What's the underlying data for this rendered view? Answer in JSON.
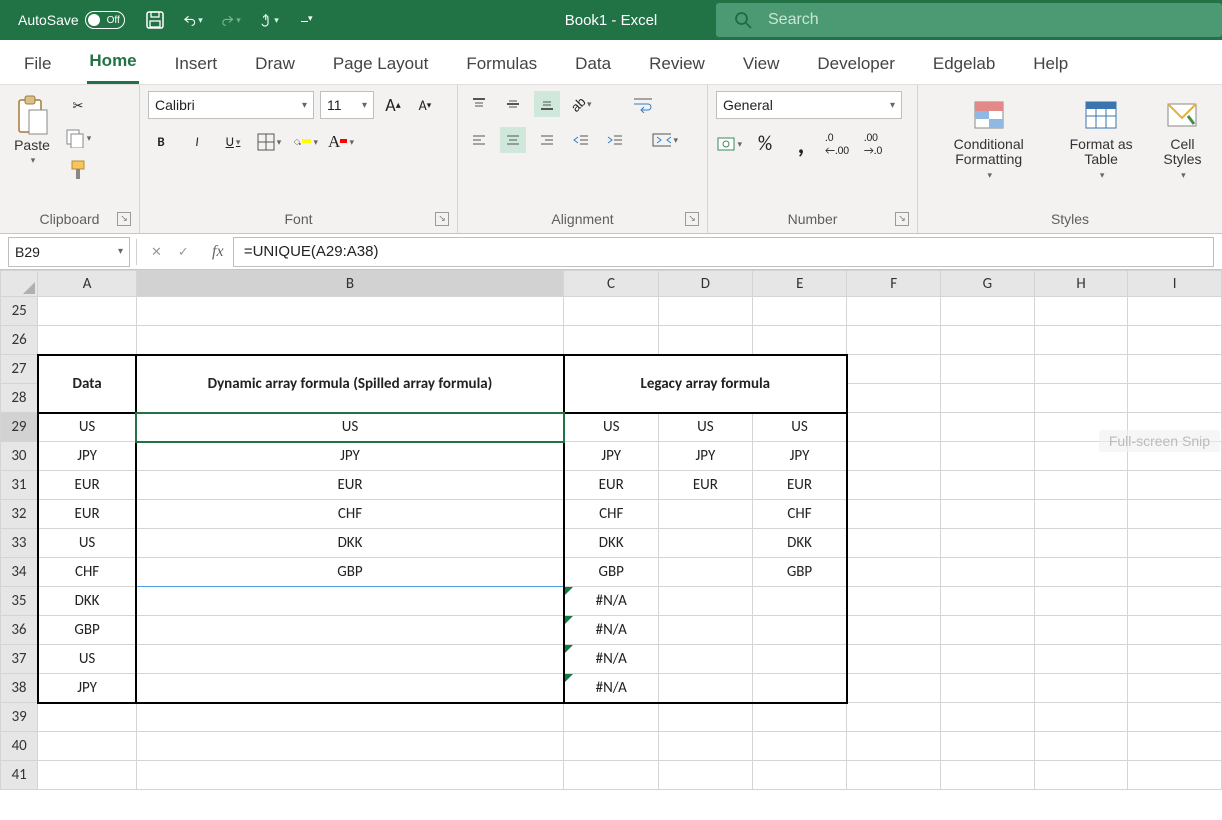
{
  "titlebar": {
    "autosave_label": "AutoSave",
    "autosave_state": "Off",
    "title": "Book1  -  Excel",
    "search_placeholder": "Search"
  },
  "tabs": [
    "File",
    "Home",
    "Insert",
    "Draw",
    "Page Layout",
    "Formulas",
    "Data",
    "Review",
    "View",
    "Developer",
    "Edgelab",
    "Help"
  ],
  "active_tab": "Home",
  "ribbon": {
    "clipboard": {
      "label": "Clipboard",
      "paste": "Paste"
    },
    "font": {
      "label": "Font",
      "name": "Calibri",
      "size": "11"
    },
    "alignment": {
      "label": "Alignment"
    },
    "number": {
      "label": "Number",
      "format": "General"
    },
    "styles": {
      "label": "Styles",
      "cond": "Conditional Formatting",
      "table": "Format as Table",
      "cellstyles": "Cell Styles"
    }
  },
  "fx": {
    "namebox": "B29",
    "formula": "=UNIQUE(A29:A38)"
  },
  "grid": {
    "columns": [
      "A",
      "B",
      "C",
      "D",
      "E",
      "F",
      "G",
      "H",
      "I"
    ],
    "row_start": 25,
    "row_end": 41,
    "headers": {
      "A": "Data",
      "B": "Dynamic array formula (Spilled array formula)",
      "CE": "Legacy array formula"
    },
    "rows": {
      "29": {
        "A": "US",
        "B": "US",
        "C": "US",
        "D": "US",
        "E": "US"
      },
      "30": {
        "A": "JPY",
        "B": "JPY",
        "C": "JPY",
        "D": "JPY",
        "E": "JPY"
      },
      "31": {
        "A": "EUR",
        "B": "EUR",
        "C": "EUR",
        "D": "EUR",
        "E": "EUR"
      },
      "32": {
        "A": "EUR",
        "B": "CHF",
        "C": "CHF",
        "D": "",
        "E": "CHF"
      },
      "33": {
        "A": "US",
        "B": "DKK",
        "C": "DKK",
        "D": "",
        "E": "DKK"
      },
      "34": {
        "A": "CHF",
        "B": "GBP",
        "C": "GBP",
        "D": "",
        "E": "GBP"
      },
      "35": {
        "A": "DKK",
        "B": "",
        "C": "#N/A",
        "D": "",
        "E": ""
      },
      "36": {
        "A": "GBP",
        "B": "",
        "C": "#N/A",
        "D": "",
        "E": ""
      },
      "37": {
        "A": "US",
        "B": "",
        "C": "#N/A",
        "D": "",
        "E": ""
      },
      "38": {
        "A": "JPY",
        "B": "",
        "C": "#N/A",
        "D": "",
        "E": ""
      }
    }
  },
  "snip": "Full-screen Snip"
}
